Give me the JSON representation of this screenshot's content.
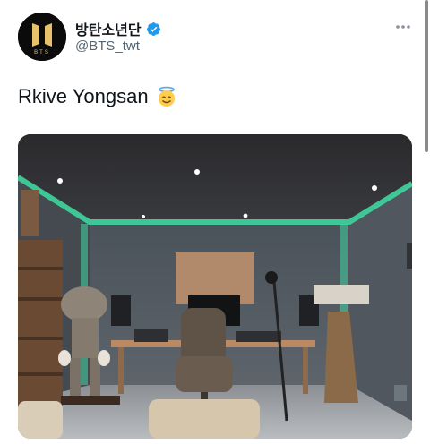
{
  "tweet": {
    "display_name": "방탄소년단",
    "handle": "@BTS_twt",
    "text": "Rkive Yongsan",
    "emoji": "smiling-face-with-halo-emoji",
    "verified_icon": "verified-badge-icon",
    "more_icon": "more-options-icon",
    "avatar_logo_text": "BTS"
  },
  "colors": {
    "verified": "#1d9bf0",
    "secondary_text": "#536471",
    "primary_text": "#0f1419",
    "studio_led": "#3fd6a0",
    "avatar_gold": "#e8c26a"
  }
}
